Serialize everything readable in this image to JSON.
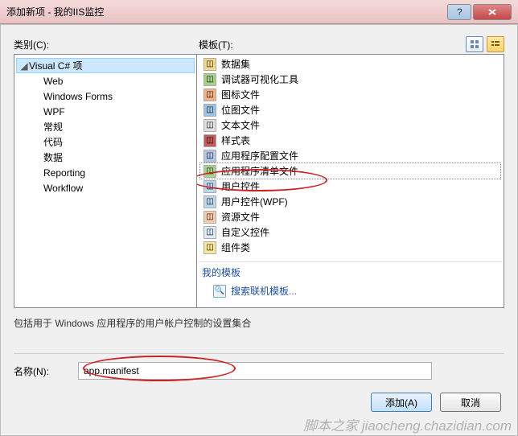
{
  "window": {
    "title": "添加新项 - 我的IIS监控"
  },
  "labels": {
    "categories": "类别(C):",
    "templates": "模板(T):",
    "name": "名称(N):",
    "my_templates": "我的模板",
    "search_online": "搜索联机模板...",
    "description": "包括用于 Windows 应用程序的用户帐户控制的设置集合"
  },
  "tree": {
    "root": "Visual C# 项",
    "children": [
      "Web",
      "Windows Forms",
      "WPF",
      "常规",
      "代码",
      "数据",
      "Reporting",
      "Workflow"
    ]
  },
  "templates": [
    {
      "icon": "db",
      "label": "数据集"
    },
    {
      "icon": "dbg",
      "label": "调试器可视化工具"
    },
    {
      "icon": "chart",
      "label": "图标文件"
    },
    {
      "icon": "bmp",
      "label": "位图文件"
    },
    {
      "icon": "txt",
      "label": "文本文件"
    },
    {
      "icon": "css",
      "label": "样式表"
    },
    {
      "icon": "cfg",
      "label": "应用程序配置文件"
    },
    {
      "icon": "manifest",
      "label": "应用程序清单文件",
      "selected": true
    },
    {
      "icon": "uc",
      "label": "用户控件"
    },
    {
      "icon": "uc",
      "label": "用户控件(WPF)"
    },
    {
      "icon": "res",
      "label": "资源文件"
    },
    {
      "icon": "custom",
      "label": "自定义控件"
    },
    {
      "icon": "asm",
      "label": "组件类"
    }
  ],
  "input": {
    "name_value": "app.manifest"
  },
  "buttons": {
    "add": "添加(A)",
    "cancel": "取消"
  },
  "watermark": "脚本之家 jiaocheng.chazidian.com"
}
